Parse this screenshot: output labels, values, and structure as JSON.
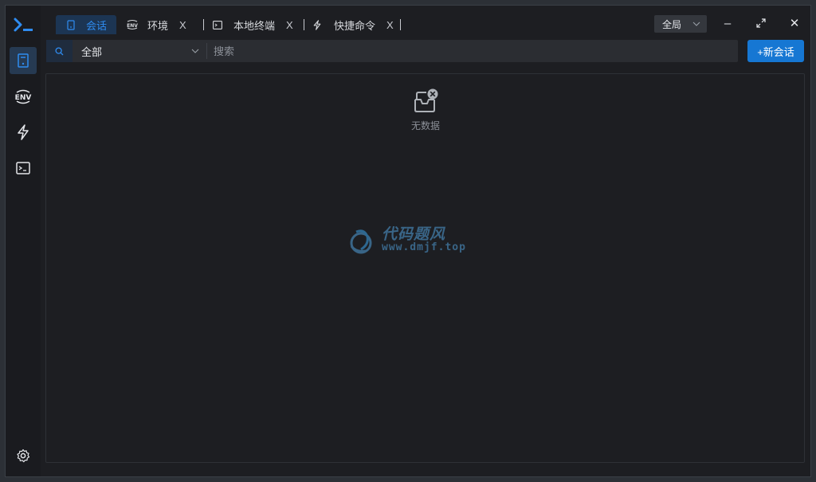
{
  "app": {
    "logo_icon": "terminal-prompt-icon",
    "accent": "#2f8cf0"
  },
  "sidebar": {
    "items": [
      {
        "icon": "server-icon",
        "active": true
      },
      {
        "icon": "env-icon"
      },
      {
        "icon": "lightning-icon"
      },
      {
        "icon": "terminal-window-icon"
      }
    ],
    "settings_icon": "gear-icon"
  },
  "tabs": [
    {
      "label": "会话",
      "icon": "server-icon",
      "active": true
    },
    {
      "label": "环境",
      "icon": "env-icon",
      "close": "X"
    },
    {
      "label": "本地终端",
      "icon": "terminal-window-icon",
      "close": "X"
    },
    {
      "label": "快捷命令",
      "icon": "lightning-icon",
      "close": "X"
    }
  ],
  "header": {
    "scope_label": "全局",
    "minimize_label": "–",
    "close_label": "✕"
  },
  "toolbar": {
    "filter_value": "全部",
    "search_placeholder": "搜索",
    "new_session_label": "+新会话"
  },
  "content": {
    "empty_text": "无数据"
  },
  "watermark": {
    "title": "代码题风",
    "url": "www.dmjf.top"
  }
}
